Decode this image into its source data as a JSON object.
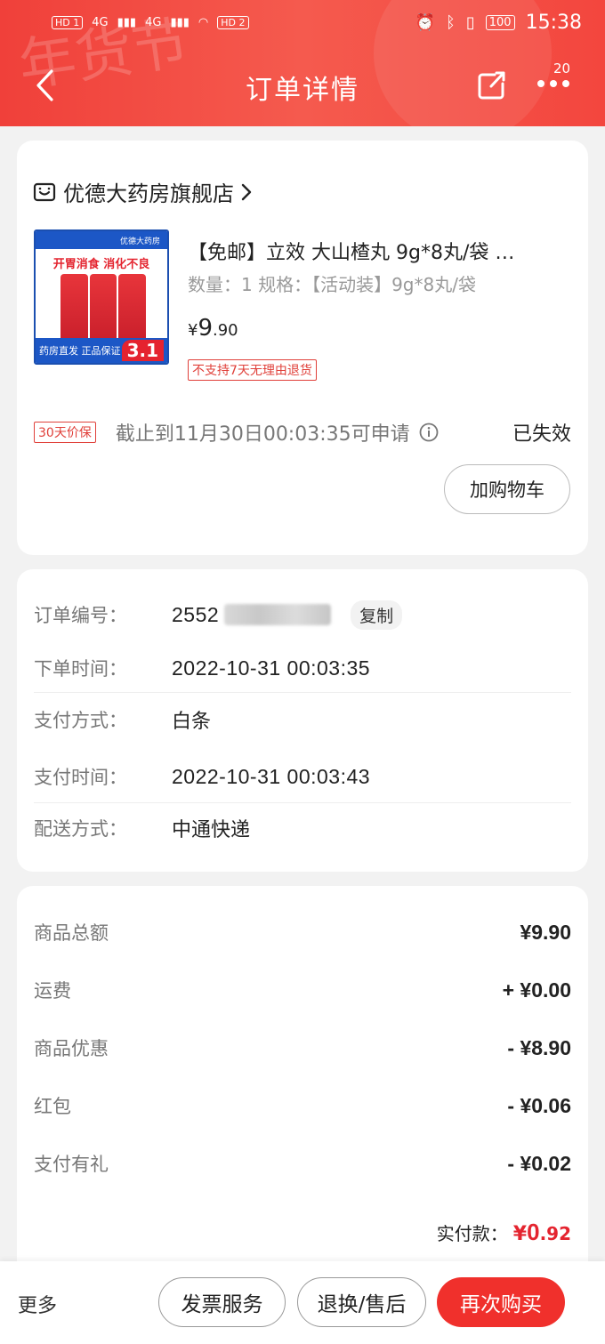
{
  "status_bar": {
    "hd1": "HD 1",
    "hd2": "HD 2",
    "net1": "4G",
    "net2": "4G",
    "battery": "100",
    "time": "15:38"
  },
  "header": {
    "decoration_text": "年货节",
    "title": "订单详情",
    "more_badge": "20"
  },
  "product_card": {
    "shop_name": "优德大药房旗舰店",
    "thumbnail": {
      "brand": "优德大药房",
      "headline": "开胃消食  消化不良",
      "foot": "药房直发  正品保证",
      "price_tag": "3.1"
    },
    "product_name": "【免邮】立效 大山楂丸 9g*8丸/袋 …",
    "quantity_spec": "数量：1   规格：【活动装】9g*8丸/袋",
    "price": {
      "currency": "¥",
      "integer": "9",
      "decimal": ".90"
    },
    "no_return_tag": "不支持7天无理由退货",
    "protect_tag": "30天价保",
    "protect_text": "截止到11月30日00:03:35可申请",
    "protect_status": "已失效",
    "add_cart_label": "加购物车"
  },
  "order_info": {
    "order_no_label": "订单编号：",
    "order_no_value": "2552",
    "copy_label": "复制",
    "order_time_label": "下单时间：",
    "order_time_value": "2022-10-31 00:03:35",
    "pay_method_label": "支付方式：",
    "pay_method_value": "白条",
    "pay_time_label": "支付时间：",
    "pay_time_value": "2022-10-31 00:03:43",
    "delivery_label": "配送方式：",
    "delivery_value": "中通快递"
  },
  "fees": [
    {
      "label": "商品总额",
      "value": "¥9.90"
    },
    {
      "label": "运费",
      "value": "+ ¥0.00"
    },
    {
      "label": "商品优惠",
      "value": "- ¥8.90"
    },
    {
      "label": "红包",
      "value": "- ¥0.06"
    },
    {
      "label": "支付有礼",
      "value": "- ¥0.02"
    }
  ],
  "paid": {
    "label": "实付款：",
    "currency": "¥",
    "integer": "0",
    "decimal": ".92"
  },
  "bottom_bar": {
    "more": "更多",
    "invoice": "发票服务",
    "after_sale": "退换/售后",
    "rebuy": "再次购买"
  },
  "colors": {
    "brand_red": "#f0403a",
    "price_red": "#e4242f"
  }
}
